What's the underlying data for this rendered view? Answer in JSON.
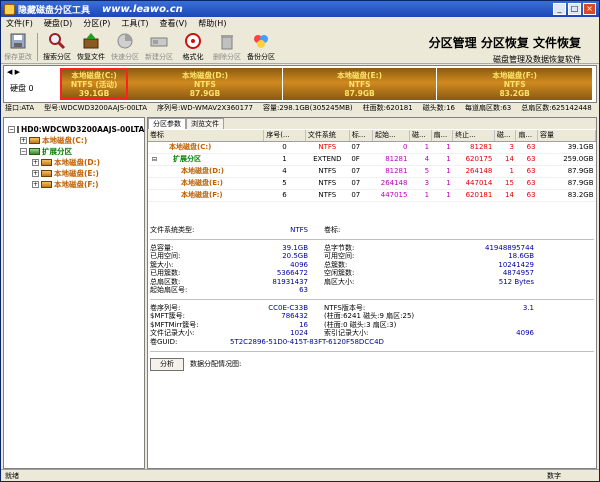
{
  "window": {
    "title": "隐藏磁盘分区工具",
    "site": "www.leawo.cn"
  },
  "menu": [
    "文件(F)",
    "硬盘(D)",
    "分区(P)",
    "工具(T)",
    "查看(V)",
    "帮助(H)"
  ],
  "toolbar": [
    {
      "label": "保存更改",
      "icon": "save-icon",
      "enabled": false
    },
    {
      "label": "搜索分区",
      "icon": "search-icon",
      "enabled": true
    },
    {
      "label": "恢复文件",
      "icon": "recover-icon",
      "enabled": true
    },
    {
      "label": "快速分区",
      "icon": "quick-partition-icon",
      "enabled": false
    },
    {
      "label": "新建分区",
      "icon": "new-partition-icon",
      "enabled": false
    },
    {
      "label": "格式化",
      "icon": "format-icon",
      "enabled": true
    },
    {
      "label": "删除分区",
      "icon": "delete-icon",
      "enabled": false
    },
    {
      "label": "备份分区",
      "icon": "backup-icon",
      "enabled": true
    }
  ],
  "banner": {
    "title": "分区管理 分区恢复 文件恢复",
    "subtitle": "磁盘管理及数据恢复软件"
  },
  "disk": {
    "label": "硬盘 0",
    "partitions": [
      {
        "name": "本地磁盘(C:)",
        "fs": "NTFS (活动)",
        "size": "39.1GB",
        "share": 0.128
      },
      {
        "name": "本地磁盘(D:)",
        "fs": "NTFS",
        "size": "87.9GB",
        "share": 0.29
      },
      {
        "name": "本地磁盘(E:)",
        "fs": "NTFS",
        "size": "87.9GB",
        "share": 0.29
      },
      {
        "name": "本地磁盘(F:)",
        "fs": "NTFS",
        "size": "83.2GB",
        "share": 0.292
      }
    ],
    "info": {
      "interface": "接口:ATA",
      "model": "型号:WDCWD3200AAJS-00LTA",
      "serial": "序列号:WD-WMAV2X360177",
      "capacity": "容量:298.1GB(305245MB)",
      "cylinders": "柱面数:620181",
      "heads": "磁头数:16",
      "sectors": "每道扇区数:63",
      "total_sectors": "总扇区数:625142448"
    }
  },
  "tree": {
    "root": "HD0:WDCWD3200AAJS-00LTA (2",
    "items": [
      {
        "label": "本地磁盘(C:)",
        "depth": 1,
        "kind": "vol"
      },
      {
        "label": "扩展分区",
        "depth": 1,
        "kind": "ext"
      },
      {
        "label": "本地磁盘(D:)",
        "depth": 2,
        "kind": "vol"
      },
      {
        "label": "本地磁盘(E:)",
        "depth": 2,
        "kind": "vol"
      },
      {
        "label": "本地磁盘(F:)",
        "depth": 2,
        "kind": "vol"
      }
    ]
  },
  "tabs": [
    "分区参数",
    "浏览文件"
  ],
  "table": {
    "headers": [
      "卷标",
      "序号(...",
      "文件系统",
      "标...",
      "起始...",
      "磁...",
      "扇...",
      "终止...",
      "磁...",
      "扇...",
      "容量"
    ],
    "rows": [
      {
        "label": "本地磁盘(C:)",
        "indent": 0,
        "kind": "vol",
        "cells": [
          "0",
          "NTFS",
          "07",
          "0",
          "1",
          "1",
          "81281",
          "3",
          "63",
          "39.1GB"
        ]
      },
      {
        "label": "扩展分区",
        "indent": 0,
        "kind": "ext",
        "cells": [
          "1",
          "EXTEND",
          "0F",
          "81281",
          "4",
          "1",
          "620175",
          "14",
          "63",
          "259.0GB"
        ]
      },
      {
        "label": "本地磁盘(D:)",
        "indent": 1,
        "kind": "vol",
        "cells": [
          "4",
          "NTFS",
          "07",
          "81281",
          "5",
          "1",
          "264148",
          "1",
          "63",
          "87.9GB"
        ]
      },
      {
        "label": "本地磁盘(E:)",
        "indent": 1,
        "kind": "vol",
        "cells": [
          "5",
          "NTFS",
          "07",
          "264148",
          "3",
          "1",
          "447014",
          "15",
          "63",
          "87.9GB"
        ]
      },
      {
        "label": "本地磁盘(F:)",
        "indent": 1,
        "kind": "vol",
        "cells": [
          "6",
          "NTFS",
          "07",
          "447015",
          "1",
          "1",
          "620181",
          "14",
          "63",
          "83.2GB"
        ]
      }
    ]
  },
  "props": {
    "fs_type": {
      "k": "文件系统类型:",
      "v": "NTFS",
      "k2": "卷标:",
      "v2": ""
    },
    "rows1": [
      {
        "k1": "总容量:",
        "v1": "39.1GB",
        "k2": "总字节数:",
        "v2": "41948895744"
      },
      {
        "k1": "已用空间:",
        "v1": "20.5GB",
        "k2": "可用空间:",
        "v2": "18.6GB"
      },
      {
        "k1": "簇大小:",
        "v1": "4096",
        "k2": "总簇数:",
        "v2": "10241429"
      },
      {
        "k1": "已用簇数:",
        "v1": "5366472",
        "k2": "空闲簇数:",
        "v2": "4874957"
      },
      {
        "k1": "总扇区数:",
        "v1": "81931437",
        "k2": "扇区大小:",
        "v2": "512 Bytes"
      },
      {
        "k1": "起始扇区号:",
        "v1": "63",
        "k2": "",
        "v2": ""
      }
    ],
    "rows2": [
      {
        "k1": "卷序列号:",
        "v1": "CC0E-C33B",
        "k2": "NTFS版本号:",
        "v2": "3.1"
      },
      {
        "k1": "$MFT簇号:",
        "v1": "786432",
        "k2": "(柱面:6241 磁头:9 扇区:25)",
        "v2": ""
      },
      {
        "k1": "$MFTMirr簇号:",
        "v1": "16",
        "k2": "(柱面:0 磁头:3 扇区:3)",
        "v2": ""
      },
      {
        "k1": "文件记录大小:",
        "v1": "1024",
        "k2": "索引记录大小:",
        "v2": "4096"
      }
    ],
    "guid": {
      "k": "卷GUID:",
      "v": "5T2C2896-51D0-415T-83FT-6120F58DCC4D"
    },
    "analyze_btn": "分析",
    "analyze_label": "数据分配情况图:"
  },
  "status": {
    "left": "就绪",
    "right": "数字"
  }
}
